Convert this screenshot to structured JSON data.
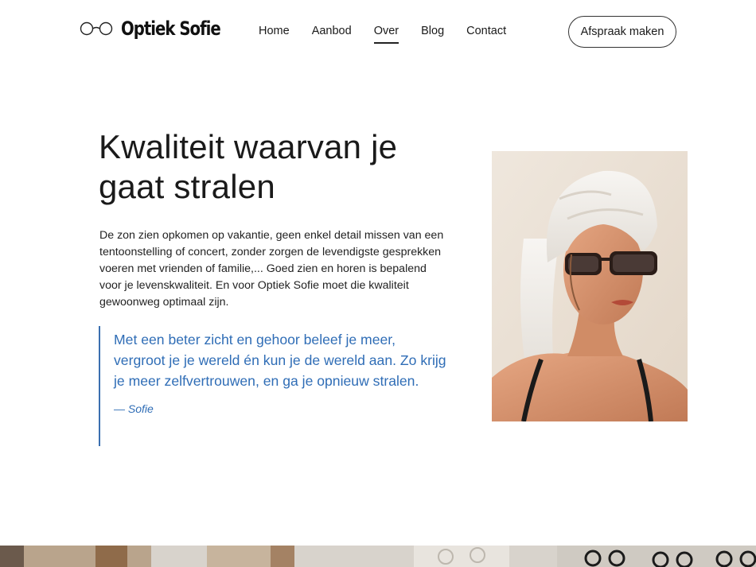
{
  "brand": {
    "name": "Optiek Sofie",
    "logo_icon": "glasses-icon"
  },
  "nav": {
    "items": [
      {
        "label": "Home",
        "active": false
      },
      {
        "label": "Aanbod",
        "active": false
      },
      {
        "label": "Over",
        "active": true
      },
      {
        "label": "Blog",
        "active": false
      },
      {
        "label": "Contact",
        "active": false
      }
    ]
  },
  "cta": {
    "label": "Afspraak maken"
  },
  "main": {
    "title_line1": "Kwaliteit waarvan je",
    "title_line2": "gaat stralen",
    "intro": "De zon zien opkomen op vakantie, geen enkel detail missen van een tentoonstelling of concert, zonder zorgen de levendigste gesprekken voeren met vrienden of familie,... Goed zien en horen is bepalend voor je levenskwaliteit. En voor Optiek Sofie moet die kwaliteit gewoonweg optimaal zijn.",
    "quote": "Met een beter zicht en gehoor beleef je meer, vergroot je je wereld én kun je de wereld aan. Zo krijg je meer zelfvertrouwen, en ga je opnieuw stralen.",
    "quote_author": "— Sofie"
  },
  "colors": {
    "accent_blue": "#2f6db6",
    "text": "#1a1a1a",
    "background": "#ffffff"
  }
}
